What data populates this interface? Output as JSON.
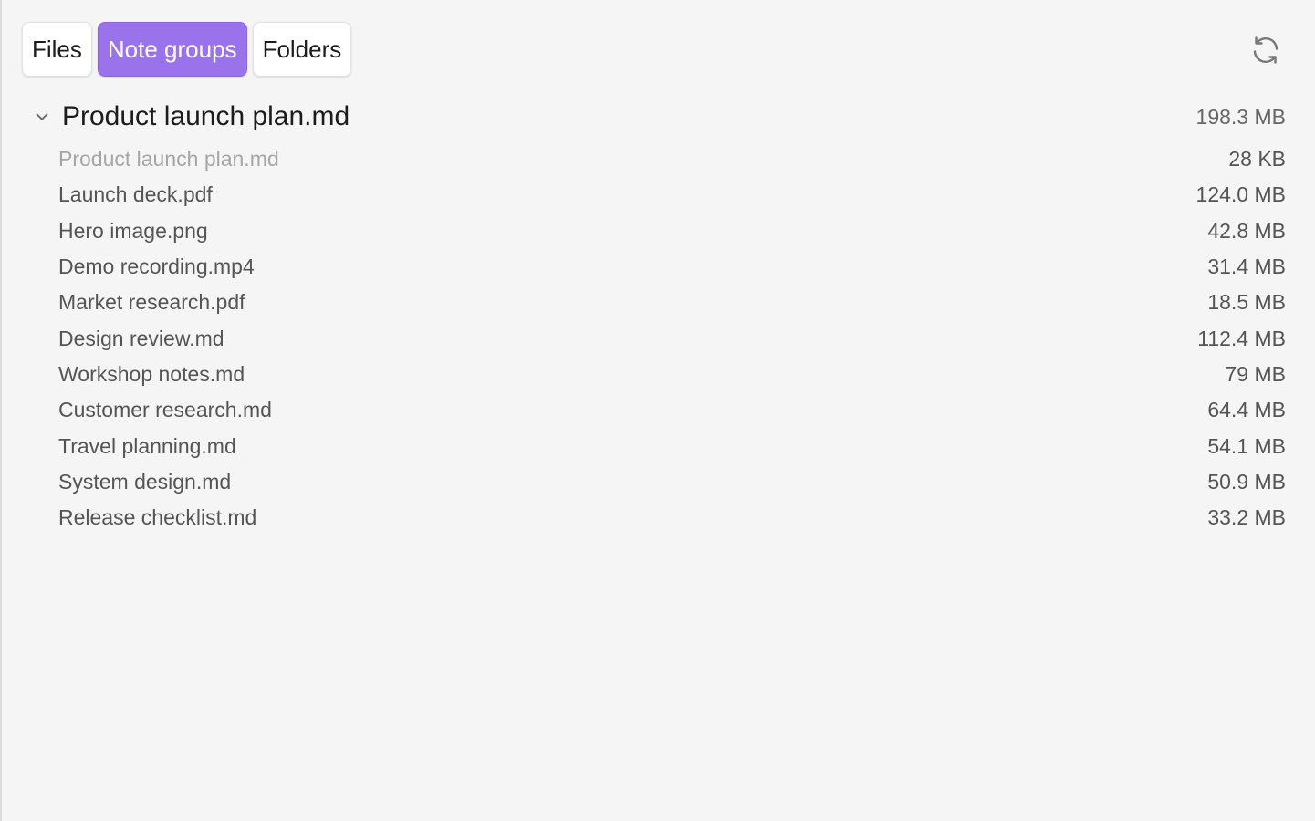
{
  "tabs": [
    {
      "label": "Files",
      "active": false
    },
    {
      "label": "Note groups",
      "active": true
    },
    {
      "label": "Folders",
      "active": false
    }
  ],
  "refresh": {
    "icon": "refresh-icon"
  },
  "group": {
    "title": "Product launch plan.md",
    "size": "198.3 MB",
    "expanded": true,
    "files": [
      {
        "name": "Product launch plan.md",
        "size": "28 KB",
        "dim": true
      },
      {
        "name": "Launch deck.pdf",
        "size": "124.0 MB"
      },
      {
        "name": "Hero image.png",
        "size": "42.8 MB"
      },
      {
        "name": "Demo recording.mp4",
        "size": "31.4 MB"
      },
      {
        "name": "Market research.pdf",
        "size": "18.5 MB"
      },
      {
        "name": "Design review.md",
        "size": "112.4 MB"
      },
      {
        "name": "Workshop notes.md",
        "size": "79 MB"
      },
      {
        "name": "Customer research.md",
        "size": "64.4 MB"
      },
      {
        "name": "Travel planning.md",
        "size": "54.1 MB"
      },
      {
        "name": "System design.md",
        "size": "50.9 MB"
      },
      {
        "name": "Release checklist.md",
        "size": "33.2 MB"
      }
    ]
  },
  "colors": {
    "accent": "#9a73ec",
    "background": "#f5f5f5",
    "dim_text": "#a6a6a6",
    "secondary_text": "#555555"
  }
}
